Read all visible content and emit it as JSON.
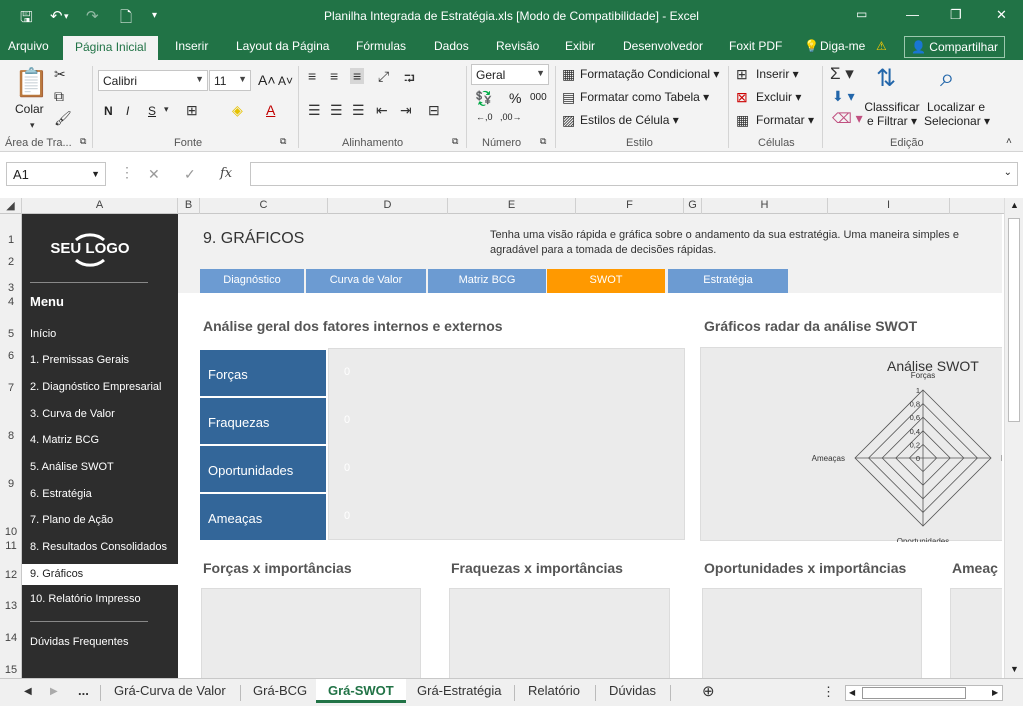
{
  "window": {
    "title": "Planilha Integrada de Estratégia.xls  [Modo de Compatibilidade] - Excel"
  },
  "menu": {
    "tabs": [
      "Arquivo",
      "Página Inicial",
      "Inserir",
      "Layout da Página",
      "Fórmulas",
      "Dados",
      "Revisão",
      "Exibir",
      "Desenvolvedor",
      "Foxit PDF"
    ],
    "tell_me": "Diga-me",
    "share": "Compartilhar"
  },
  "ribbon": {
    "clipboard": {
      "paste": "Colar",
      "label": "Área de Tra..."
    },
    "font": {
      "name": "Calibri",
      "size": "11",
      "bold": "N",
      "italic": "I",
      "underline": "S",
      "label": "Fonte"
    },
    "alignment": {
      "label": "Alinhamento"
    },
    "number": {
      "format": "Geral",
      "percent": "%",
      "thousands": "000",
      "label": "Número"
    },
    "styles": {
      "conditional": "Formatação Condicional",
      "table": "Formatar como Tabela",
      "cell_styles": "Estilos de Célula",
      "label": "Estilo"
    },
    "cells": {
      "insert": "Inserir",
      "delete": "Excluir",
      "format": "Formatar",
      "label": "Células"
    },
    "editing": {
      "sort1": "Classificar",
      "sort2": "e Filtrar",
      "find1": "Localizar e",
      "find2": "Selecionar",
      "label": "Edição"
    }
  },
  "formula_bar": {
    "name_box": "A1",
    "fx": "fx",
    "value": ""
  },
  "columns": [
    "A",
    "B",
    "C",
    "D",
    "E",
    "F",
    "G",
    "H",
    "I"
  ],
  "rows": [
    "1",
    "2",
    "3",
    "4",
    "5",
    "6",
    "7",
    "8",
    "9",
    "10",
    "11",
    "12",
    "13",
    "14",
    "15"
  ],
  "sidebar": {
    "logo": "SEU LOGO",
    "menu_title": "Menu",
    "items": [
      "Início",
      "1. Premissas Gerais",
      "2. Diagnóstico Empresarial",
      "3. Curva de Valor",
      "4. Matriz BCG",
      "5. Análise SWOT",
      "6. Estratégia",
      "7. Plano de Ação",
      "8. Resultados Consolidados",
      "9. Gráficos",
      "10. Relatório Impresso",
      "Dúvidas Frequentes"
    ]
  },
  "page": {
    "title": "9. GRÁFICOS",
    "description": "Tenha uma visão rápida e gráfica sobre o andamento da sua estratégia. Uma maneira simples e agradável para a tomada de decisões rápidas.",
    "subtabs": [
      "Diagnóstico",
      "Curva de Valor",
      "Matriz BCG",
      "SWOT",
      "Estratégia"
    ],
    "analysis_title": "Análise geral dos fatores internos e externos",
    "radar_section_title": "Gráficos radar da análise SWOT",
    "swot": [
      {
        "label": "Forças",
        "value": "0"
      },
      {
        "label": "Fraquezas",
        "value": "0"
      },
      {
        "label": "Oportunidades",
        "value": "0"
      },
      {
        "label": "Ameaças",
        "value": "0"
      }
    ],
    "bottom_titles": [
      "Forças x importâncias",
      "Fraquezas x importâncias",
      "Oportunidades x importâncias",
      "Ameaç"
    ]
  },
  "chart_data": {
    "type": "radar",
    "title": "Análise SWOT",
    "axes": [
      "Forças",
      "F",
      "Oportunidades",
      "Ameaças"
    ],
    "ticks": [
      "1",
      "0,8",
      "0,6",
      "0,4",
      "0,2",
      "0"
    ],
    "rlim": [
      0,
      1
    ],
    "series": [
      {
        "values": [
          0,
          0,
          0,
          0
        ]
      }
    ]
  },
  "sheet_tabs": {
    "ellipsis": "...",
    "tabs": [
      "Grá-Curva de Valor",
      "Grá-BCG",
      "Grá-SWOT",
      "Grá-Estratégia",
      "Relatório",
      "Dúvidas"
    ]
  },
  "colors": {
    "excel_green": "#217346",
    "sidebar": "#2d2d2d",
    "swot_blue": "#336699",
    "subtab_blue": "#6c9bd2",
    "subtab_active": "#ff9900"
  }
}
